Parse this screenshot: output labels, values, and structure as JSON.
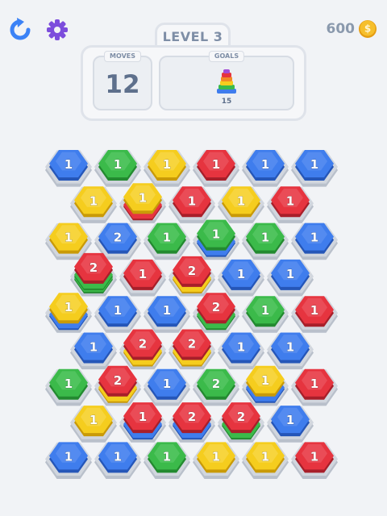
{
  "header": {
    "restart_icon": "restart-icon",
    "settings_icon": "gear-icon",
    "coins": "600",
    "coin_icon": "dollar-coin-icon",
    "level_label": "LEVEL 3"
  },
  "stats": {
    "moves_label": "MOVES",
    "moves_value": "12",
    "goals_label": "GOALS",
    "goal_value": "15",
    "goal_icon": "rainbow-stack-icon"
  },
  "colors": {
    "blue": "#3f7ded",
    "green": "#3bba4a",
    "yellow": "#f5cd1e",
    "red": "#e6343f",
    "slot": "#d1d6de",
    "accent": "#3b82f6",
    "settings": "#7c4ddc",
    "coin": "#f4b324"
  },
  "board": {
    "rows": [
      [
        {
          "c": "blue",
          "v": "1",
          "under": []
        },
        {
          "c": "green",
          "v": "1",
          "under": []
        },
        {
          "c": "yellow",
          "v": "1",
          "under": []
        },
        {
          "c": "red",
          "v": "1",
          "under": []
        },
        {
          "c": "blue",
          "v": "1",
          "under": []
        },
        {
          "c": "blue",
          "v": "1",
          "under": []
        }
      ],
      [
        {
          "c": "yellow",
          "v": "1",
          "under": []
        },
        {
          "c": "yellow",
          "v": "1",
          "under": [
            "red"
          ]
        },
        {
          "c": "red",
          "v": "1",
          "under": []
        },
        {
          "c": "yellow",
          "v": "1",
          "under": []
        },
        {
          "c": "red",
          "v": "1",
          "under": []
        }
      ],
      [
        {
          "c": "yellow",
          "v": "1",
          "under": []
        },
        {
          "c": "blue",
          "v": "2",
          "under": []
        },
        {
          "c": "green",
          "v": "1",
          "under": []
        },
        {
          "c": "green",
          "v": "1",
          "under": [
            "blue"
          ]
        },
        {
          "c": "green",
          "v": "1",
          "under": []
        },
        {
          "c": "blue",
          "v": "1",
          "under": []
        }
      ],
      [
        {
          "c": "red",
          "v": "2",
          "under": [
            "green",
            "green"
          ]
        },
        {
          "c": "red",
          "v": "1",
          "under": []
        },
        {
          "c": "red",
          "v": "2",
          "under": [
            "yellow"
          ]
        },
        {
          "c": "blue",
          "v": "1",
          "under": []
        },
        {
          "c": "blue",
          "v": "1",
          "under": []
        }
      ],
      [
        {
          "c": "yellow",
          "v": "1",
          "under": [
            "blue"
          ]
        },
        {
          "c": "blue",
          "v": "1",
          "under": []
        },
        {
          "c": "blue",
          "v": "1",
          "under": []
        },
        {
          "c": "red",
          "v": "2",
          "under": [
            "green"
          ]
        },
        {
          "c": "green",
          "v": "1",
          "under": []
        },
        {
          "c": "red",
          "v": "1",
          "under": []
        }
      ],
      [
        {
          "c": "blue",
          "v": "1",
          "under": []
        },
        {
          "c": "red",
          "v": "2",
          "under": [
            "yellow"
          ]
        },
        {
          "c": "red",
          "v": "2",
          "under": [
            "yellow"
          ]
        },
        {
          "c": "blue",
          "v": "1",
          "under": []
        },
        {
          "c": "blue",
          "v": "1",
          "under": []
        }
      ],
      [
        {
          "c": "green",
          "v": "1",
          "under": []
        },
        {
          "c": "red",
          "v": "2",
          "under": [
            "yellow"
          ]
        },
        {
          "c": "blue",
          "v": "1",
          "under": []
        },
        {
          "c": "green",
          "v": "2",
          "under": []
        },
        {
          "c": "yellow",
          "v": "1",
          "under": [
            "blue"
          ]
        },
        {
          "c": "red",
          "v": "1",
          "under": []
        }
      ],
      [
        {
          "c": "yellow",
          "v": "1",
          "under": []
        },
        {
          "c": "red",
          "v": "1",
          "under": [
            "blue"
          ]
        },
        {
          "c": "red",
          "v": "2",
          "under": [
            "blue"
          ]
        },
        {
          "c": "red",
          "v": "2",
          "under": [
            "green"
          ]
        },
        {
          "c": "blue",
          "v": "1",
          "under": []
        }
      ],
      [
        {
          "c": "blue",
          "v": "1",
          "under": []
        },
        {
          "c": "blue",
          "v": "1",
          "under": []
        },
        {
          "c": "green",
          "v": "1",
          "under": []
        },
        {
          "c": "yellow",
          "v": "1",
          "under": []
        },
        {
          "c": "yellow",
          "v": "1",
          "under": []
        },
        {
          "c": "red",
          "v": "1",
          "under": []
        }
      ]
    ]
  }
}
